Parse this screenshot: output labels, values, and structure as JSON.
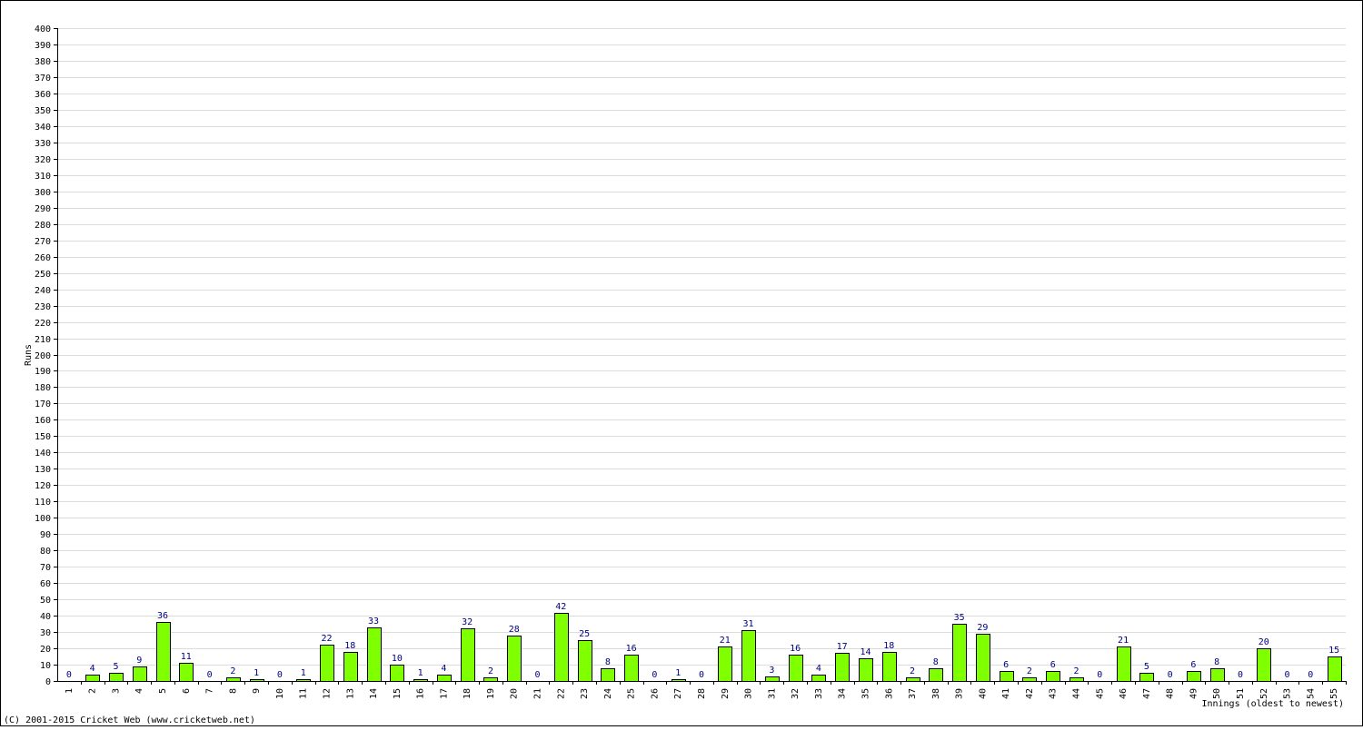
{
  "chart_data": {
    "type": "bar",
    "title": "",
    "xlabel": "Innings (oldest to newest)",
    "ylabel": "Runs",
    "ylim": [
      0,
      400
    ],
    "ytick_step": 10,
    "grid": true,
    "bar_color": "#80ff00",
    "label_color": "#000080",
    "categories": [
      "1",
      "2",
      "3",
      "4",
      "5",
      "6",
      "7",
      "8",
      "9",
      "10",
      "11",
      "12",
      "13",
      "14",
      "15",
      "16",
      "17",
      "18",
      "19",
      "20",
      "21",
      "22",
      "23",
      "24",
      "25",
      "26",
      "27",
      "28",
      "29",
      "30",
      "31",
      "32",
      "33",
      "34",
      "35",
      "36",
      "37",
      "38",
      "39",
      "40",
      "41",
      "42",
      "43",
      "44",
      "45",
      "46",
      "47",
      "48",
      "49",
      "50",
      "51",
      "52",
      "53",
      "54",
      "55"
    ],
    "values": [
      0,
      4,
      5,
      9,
      36,
      11,
      0,
      2,
      1,
      0,
      1,
      22,
      18,
      33,
      10,
      1,
      4,
      32,
      2,
      28,
      0,
      42,
      25,
      8,
      16,
      0,
      1,
      0,
      21,
      31,
      3,
      16,
      4,
      17,
      14,
      18,
      2,
      8,
      35,
      29,
      6,
      2,
      6,
      2,
      0,
      21,
      5,
      0,
      6,
      8,
      0,
      20,
      0,
      0,
      15
    ]
  },
  "footer": {
    "copyright": "(C) 2001-2015 Cricket Web (www.cricketweb.net)"
  }
}
